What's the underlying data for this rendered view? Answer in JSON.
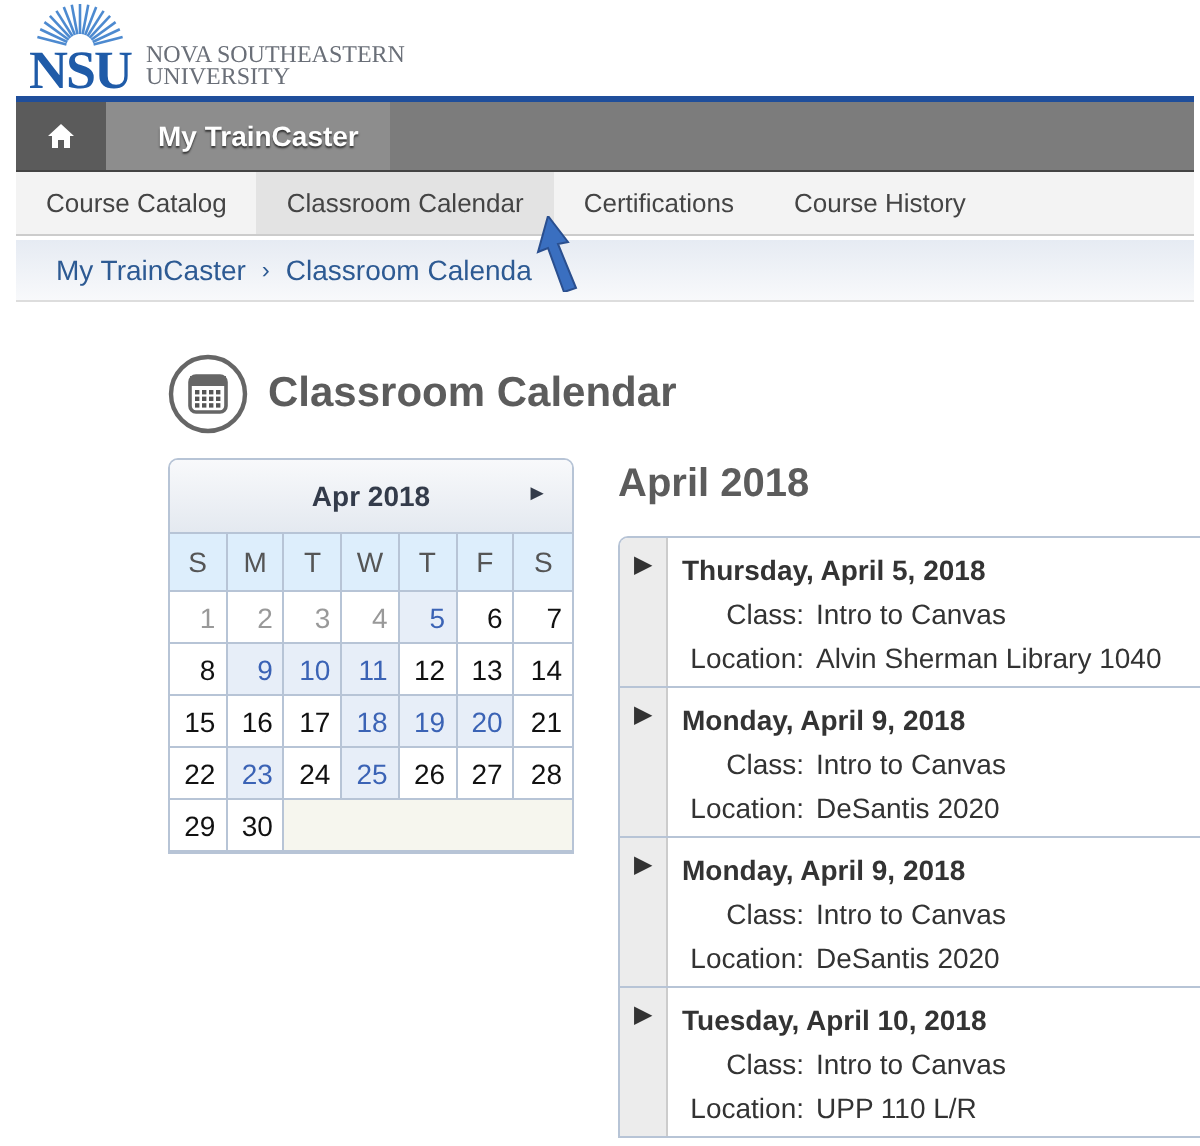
{
  "logo": {
    "mark": "NSU",
    "name_line_1": "NOVA SOUTHEASTERN",
    "name_line_2": "UNIVERSITY"
  },
  "top_nav": [
    {
      "kind": "home",
      "selected": false
    },
    {
      "kind": "text",
      "label": "My TrainCaster",
      "selected": true
    }
  ],
  "sub_nav": [
    {
      "label": "Course Catalog",
      "selected": false
    },
    {
      "label": "Classroom Calendar",
      "selected": true
    },
    {
      "label": "Certifications",
      "selected": false
    },
    {
      "label": "Course History",
      "selected": false
    }
  ],
  "breadcrumb": {
    "items": [
      "My TrainCaster",
      "Classroom Calenda"
    ],
    "separator": "›"
  },
  "page_title": "Classroom Calendar",
  "mini_calendar": {
    "month": "Apr 2018",
    "next": "►",
    "weekdays": [
      "S",
      "M",
      "T",
      "W",
      "T",
      "F",
      "S"
    ],
    "weeks": [
      [
        {
          "day": "1",
          "kind": "past"
        },
        {
          "day": "2",
          "kind": "past"
        },
        {
          "day": "3",
          "kind": "past"
        },
        {
          "day": "4",
          "kind": "past"
        },
        {
          "day": "5",
          "kind": "event"
        },
        {
          "day": "6",
          "kind": "normal"
        },
        {
          "day": "7",
          "kind": "normal"
        }
      ],
      [
        {
          "day": "8",
          "kind": "normal"
        },
        {
          "day": "9",
          "kind": "event"
        },
        {
          "day": "10",
          "kind": "event"
        },
        {
          "day": "11",
          "kind": "event"
        },
        {
          "day": "12",
          "kind": "normal"
        },
        {
          "day": "13",
          "kind": "normal"
        },
        {
          "day": "14",
          "kind": "normal"
        }
      ],
      [
        {
          "day": "15",
          "kind": "normal"
        },
        {
          "day": "16",
          "kind": "normal"
        },
        {
          "day": "17",
          "kind": "normal"
        },
        {
          "day": "18",
          "kind": "event"
        },
        {
          "day": "19",
          "kind": "event"
        },
        {
          "day": "20",
          "kind": "event"
        },
        {
          "day": "21",
          "kind": "normal"
        }
      ],
      [
        {
          "day": "22",
          "kind": "normal"
        },
        {
          "day": "23",
          "kind": "event"
        },
        {
          "day": "24",
          "kind": "normal"
        },
        {
          "day": "25",
          "kind": "event"
        },
        {
          "day": "26",
          "kind": "normal"
        },
        {
          "day": "27",
          "kind": "normal"
        },
        {
          "day": "28",
          "kind": "normal"
        }
      ],
      [
        {
          "day": "29",
          "kind": "normal"
        },
        {
          "day": "30",
          "kind": "normal"
        }
      ]
    ]
  },
  "events_heading": "April 2018",
  "events": [
    {
      "expander": "▶",
      "date": "Thursday, April 5, 2018",
      "class_label": "Class:",
      "class_value": "Intro to Canvas",
      "location_label": "Location:",
      "location_value": "Alvin Sherman Library 1040"
    },
    {
      "expander": "▶",
      "date": "Monday, April 9, 2018",
      "class_label": "Class:",
      "class_value": "Intro to Canvas",
      "location_label": "Location:",
      "location_value": "DeSantis 2020"
    },
    {
      "expander": "▶",
      "date": "Monday, April 9, 2018",
      "class_label": "Class:",
      "class_value": "Intro to Canvas",
      "location_label": "Location:",
      "location_value": "DeSantis 2020"
    },
    {
      "expander": "▶",
      "date": "Tuesday, April 10, 2018",
      "class_label": "Class:",
      "class_value": "Intro to Canvas",
      "location_label": "Location:",
      "location_value": "UPP 110 L/R"
    }
  ]
}
